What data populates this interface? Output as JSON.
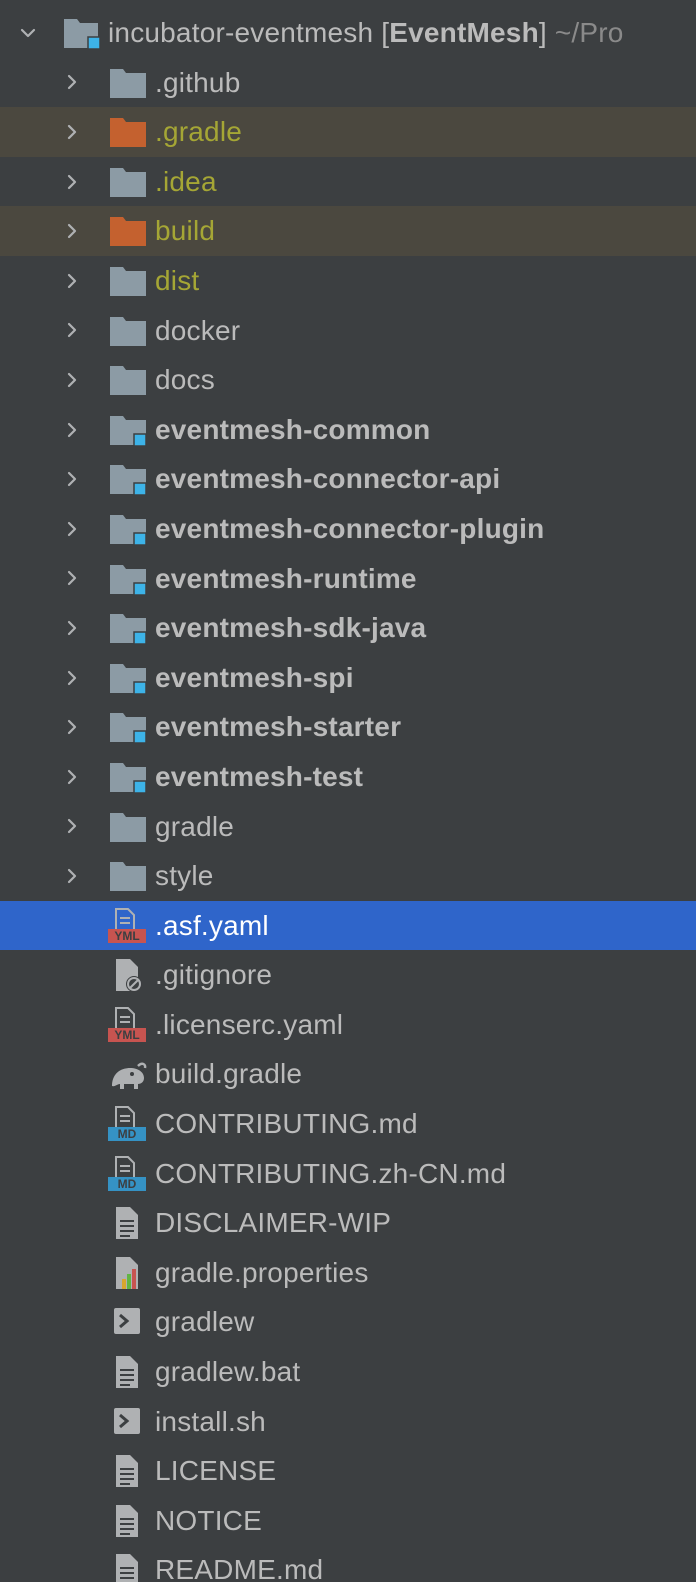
{
  "project_tree": {
    "root": {
      "name": "incubator-eventmesh",
      "module_open": "[",
      "module_name": "EventMesh",
      "module_close": "]",
      "path_hint": "~/Pro",
      "expanded": true
    },
    "items": [
      {
        "name": ".github",
        "kind": "folder",
        "expandable": true
      },
      {
        "name": ".gradle",
        "kind": "excluded-folder",
        "expandable": true,
        "style": "excluded"
      },
      {
        "name": ".idea",
        "kind": "folder",
        "expandable": true,
        "style": "olive"
      },
      {
        "name": "build",
        "kind": "excluded-folder",
        "expandable": true,
        "style": "excluded"
      },
      {
        "name": "dist",
        "kind": "folder",
        "expandable": true,
        "style": "olive"
      },
      {
        "name": "docker",
        "kind": "folder",
        "expandable": true
      },
      {
        "name": "docs",
        "kind": "folder",
        "expandable": true
      },
      {
        "name": "eventmesh-common",
        "kind": "module",
        "expandable": true
      },
      {
        "name": "eventmesh-connector-api",
        "kind": "module",
        "expandable": true
      },
      {
        "name": "eventmesh-connector-plugin",
        "kind": "module",
        "expandable": true
      },
      {
        "name": "eventmesh-runtime",
        "kind": "module",
        "expandable": true
      },
      {
        "name": "eventmesh-sdk-java",
        "kind": "module",
        "expandable": true
      },
      {
        "name": "eventmesh-spi",
        "kind": "module",
        "expandable": true
      },
      {
        "name": "eventmesh-starter",
        "kind": "module",
        "expandable": true
      },
      {
        "name": "eventmesh-test",
        "kind": "module",
        "expandable": true
      },
      {
        "name": "gradle",
        "kind": "folder",
        "expandable": true
      },
      {
        "name": "style",
        "kind": "folder",
        "expandable": true
      },
      {
        "name": ".asf.yaml",
        "kind": "yml",
        "expandable": false,
        "selected": true
      },
      {
        "name": ".gitignore",
        "kind": "ignore",
        "expandable": false
      },
      {
        "name": ".licenserc.yaml",
        "kind": "yml",
        "expandable": false
      },
      {
        "name": "build.gradle",
        "kind": "gradle",
        "expandable": false
      },
      {
        "name": "CONTRIBUTING.md",
        "kind": "md",
        "expandable": false
      },
      {
        "name": "CONTRIBUTING.zh-CN.md",
        "kind": "md",
        "expandable": false
      },
      {
        "name": "DISCLAIMER-WIP",
        "kind": "text",
        "expandable": false
      },
      {
        "name": "gradle.properties",
        "kind": "properties",
        "expandable": false
      },
      {
        "name": "gradlew",
        "kind": "shell",
        "expandable": false
      },
      {
        "name": "gradlew.bat",
        "kind": "text",
        "expandable": false
      },
      {
        "name": "install.sh",
        "kind": "shell",
        "expandable": false
      },
      {
        "name": "LICENSE",
        "kind": "text",
        "expandable": false
      },
      {
        "name": "NOTICE",
        "kind": "text",
        "expandable": false
      },
      {
        "name": "README.md",
        "kind": "text",
        "expandable": false
      }
    ],
    "icon_labels": {
      "yml": "YML",
      "md": "MD"
    }
  },
  "colors": {
    "background": "#3c3f41",
    "excluded_row": "#4b483f",
    "selected_row": "#2f65ca",
    "folder": "#8c9ba5",
    "excluded_folder": "#c4612f",
    "module_badge": "#3db3e8",
    "olive_text": "#a5a635",
    "text": "#bbbbbb"
  }
}
